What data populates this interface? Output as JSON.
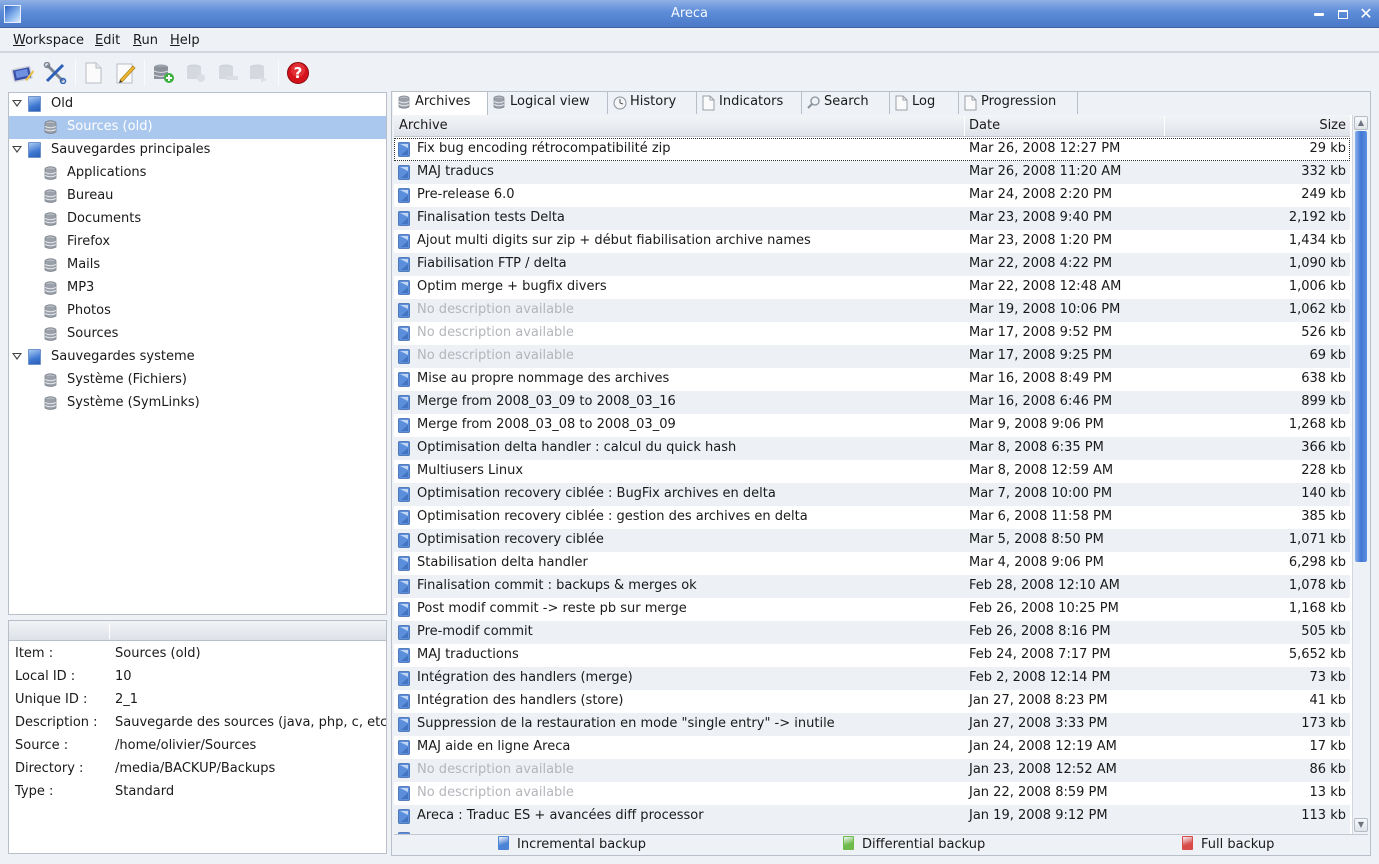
{
  "window": {
    "title": "Areca",
    "controls": [
      "minimize",
      "maximize",
      "close"
    ]
  },
  "menu": [
    {
      "label": "Workspace",
      "mnemonic": "W",
      "rest": "orkspace"
    },
    {
      "label": "Edit",
      "mnemonic": "E",
      "rest": "dit"
    },
    {
      "label": "Run",
      "mnemonic": "R",
      "rest": "un"
    },
    {
      "label": "Help",
      "mnemonic": "H",
      "rest": "elp"
    }
  ],
  "toolbar": [
    {
      "icon": "open-workspace-icon",
      "enabled": true
    },
    {
      "icon": "preferences-tools-icon",
      "enabled": true
    },
    {
      "icon": "new-document-icon",
      "enabled": true
    },
    {
      "icon": "edit-pencil-icon",
      "enabled": true
    },
    {
      "icon": "add-target-icon",
      "enabled": true
    },
    {
      "icon": "target-action-1-icon",
      "enabled": false
    },
    {
      "icon": "target-action-2-icon",
      "enabled": false
    },
    {
      "icon": "target-action-3-icon",
      "enabled": false
    },
    {
      "icon": "help-icon",
      "enabled": true
    }
  ],
  "tree": [
    {
      "label": "Old",
      "type": "group",
      "expanded": true,
      "level": 0
    },
    {
      "label": "Sources (old)",
      "type": "target",
      "level": 1,
      "selected": true
    },
    {
      "label": "Sauvegardes principales",
      "type": "group",
      "expanded": true,
      "level": 0
    },
    {
      "label": "Applications",
      "type": "target",
      "level": 1
    },
    {
      "label": "Bureau",
      "type": "target",
      "level": 1
    },
    {
      "label": "Documents",
      "type": "target",
      "level": 1
    },
    {
      "label": "Firefox",
      "type": "target",
      "level": 1
    },
    {
      "label": "Mails",
      "type": "target",
      "level": 1
    },
    {
      "label": "MP3",
      "type": "target",
      "level": 1
    },
    {
      "label": "Photos",
      "type": "target",
      "level": 1
    },
    {
      "label": "Sources",
      "type": "target",
      "level": 1
    },
    {
      "label": "Sauvegardes systeme",
      "type": "group",
      "expanded": true,
      "level": 0
    },
    {
      "label": "Système (Fichiers)",
      "type": "target",
      "level": 1
    },
    {
      "label": "Système (SymLinks)",
      "type": "target",
      "level": 1
    }
  ],
  "properties": [
    {
      "key": "Item :",
      "value": "Sources (old)"
    },
    {
      "key": "Local ID :",
      "value": "10"
    },
    {
      "key": "Unique ID :",
      "value": "2_1"
    },
    {
      "key": "Description :",
      "value": "Sauvegarde des sources (java, php, c, etc."
    },
    {
      "key": "Source :",
      "value": "/home/olivier/Sources"
    },
    {
      "key": "Directory :",
      "value": "/media/BACKUP/Backups"
    },
    {
      "key": "Type :",
      "value": "Standard"
    }
  ],
  "tabs": [
    {
      "label": "Archives",
      "icon": "database-icon",
      "active": true
    },
    {
      "label": "Logical view",
      "icon": "database-icon"
    },
    {
      "label": "History",
      "icon": "clock-icon"
    },
    {
      "label": "Indicators",
      "icon": "page-icon"
    },
    {
      "label": "Search",
      "icon": "magnifier-icon"
    },
    {
      "label": "Log",
      "icon": "page-icon"
    },
    {
      "label": "Progression",
      "icon": "page-icon"
    }
  ],
  "archives": {
    "columns": {
      "archive": "Archive",
      "date": "Date",
      "size": "Size"
    },
    "rows": [
      {
        "name": "Fix bug encoding rétrocompatibilité zip",
        "date": "Mar 26, 2008 12:27 PM",
        "size": "29 kb",
        "focused": true
      },
      {
        "name": "MAJ traducs",
        "date": "Mar 26, 2008 11:20 AM",
        "size": "332 kb"
      },
      {
        "name": "Pre-release 6.0",
        "date": "Mar 24, 2008 2:20 PM",
        "size": "249 kb"
      },
      {
        "name": "Finalisation tests Delta",
        "date": "Mar 23, 2008 9:40 PM",
        "size": "2,192 kb"
      },
      {
        "name": "Ajout multi digits sur zip + début fiabilisation archive names",
        "date": "Mar 23, 2008 1:20 PM",
        "size": "1,434 kb"
      },
      {
        "name": "Fiabilisation FTP / delta",
        "date": "Mar 22, 2008 4:22 PM",
        "size": "1,090 kb"
      },
      {
        "name": "Optim merge + bugfix divers",
        "date": "Mar 22, 2008 12:48 AM",
        "size": "1,006 kb"
      },
      {
        "name": "No description available",
        "date": "Mar 19, 2008 10:06 PM",
        "size": "1,062 kb",
        "muted": true
      },
      {
        "name": "No description available",
        "date": "Mar 17, 2008 9:52 PM",
        "size": "526 kb",
        "muted": true
      },
      {
        "name": "No description available",
        "date": "Mar 17, 2008 9:25 PM",
        "size": "69 kb",
        "muted": true
      },
      {
        "name": "Mise au propre nommage des archives",
        "date": "Mar 16, 2008 8:49 PM",
        "size": "638 kb"
      },
      {
        "name": "Merge from 2008_03_09 to 2008_03_16",
        "date": "Mar 16, 2008 6:46 PM",
        "size": "899 kb"
      },
      {
        "name": "Merge from 2008_03_08 to 2008_03_09",
        "date": "Mar 9, 2008 9:06 PM",
        "size": "1,268 kb"
      },
      {
        "name": "Optimisation delta handler : calcul du quick hash",
        "date": "Mar 8, 2008 6:35 PM",
        "size": "366 kb"
      },
      {
        "name": "Multiusers Linux",
        "date": "Mar 8, 2008 12:59 AM",
        "size": "228 kb"
      },
      {
        "name": "Optimisation recovery ciblée : BugFix archives en delta",
        "date": "Mar 7, 2008 10:00 PM",
        "size": "140 kb"
      },
      {
        "name": "Optimisation recovery ciblée : gestion des archives en delta",
        "date": "Mar 6, 2008 11:58 PM",
        "size": "385 kb"
      },
      {
        "name": "Optimisation recovery ciblée",
        "date": "Mar 5, 2008 8:50 PM",
        "size": "1,071 kb"
      },
      {
        "name": "Stabilisation delta handler",
        "date": "Mar 4, 2008 9:06 PM",
        "size": "6,298 kb"
      },
      {
        "name": "Finalisation commit : backups & merges ok",
        "date": "Feb 28, 2008 12:10 AM",
        "size": "1,078 kb"
      },
      {
        "name": "Post modif commit -> reste pb sur merge",
        "date": "Feb 26, 2008 10:25 PM",
        "size": "1,168 kb"
      },
      {
        "name": "Pre-modif commit",
        "date": "Feb 26, 2008 8:16 PM",
        "size": "505 kb"
      },
      {
        "name": "MAJ traductions",
        "date": "Feb 24, 2008 7:17 PM",
        "size": "5,652 kb"
      },
      {
        "name": "Intégration des handlers (merge)",
        "date": "Feb 2, 2008 12:14 PM",
        "size": "73 kb"
      },
      {
        "name": "Intégration des handlers (store)",
        "date": "Jan 27, 2008 8:23 PM",
        "size": "41 kb"
      },
      {
        "name": "Suppression de la restauration en mode \"single entry\" -> inutile",
        "date": "Jan 27, 2008 3:33 PM",
        "size": "173 kb"
      },
      {
        "name": "MAJ aide en ligne Areca",
        "date": "Jan 24, 2008 12:19 AM",
        "size": "17 kb"
      },
      {
        "name": "No description available",
        "date": "Jan 23, 2008 12:52 AM",
        "size": "86 kb",
        "muted": true
      },
      {
        "name": "No description available",
        "date": "Jan 22, 2008 8:59 PM",
        "size": "13 kb",
        "muted": true
      },
      {
        "name": "Areca : Traduc ES + avancées diff processor",
        "date": "Jan 19, 2008 9:12 PM",
        "size": "113 kb"
      }
    ]
  },
  "legend": [
    {
      "label": "Incremental backup",
      "color": "#4a82d6"
    },
    {
      "label": "Differential backup",
      "color": "#6dbb4a"
    },
    {
      "label": "Full backup",
      "color": "#d94a4a"
    }
  ],
  "colors": {
    "selection": "#aac7ee",
    "accent": "#4a79c8",
    "muted_text": "#b3b6bb"
  }
}
